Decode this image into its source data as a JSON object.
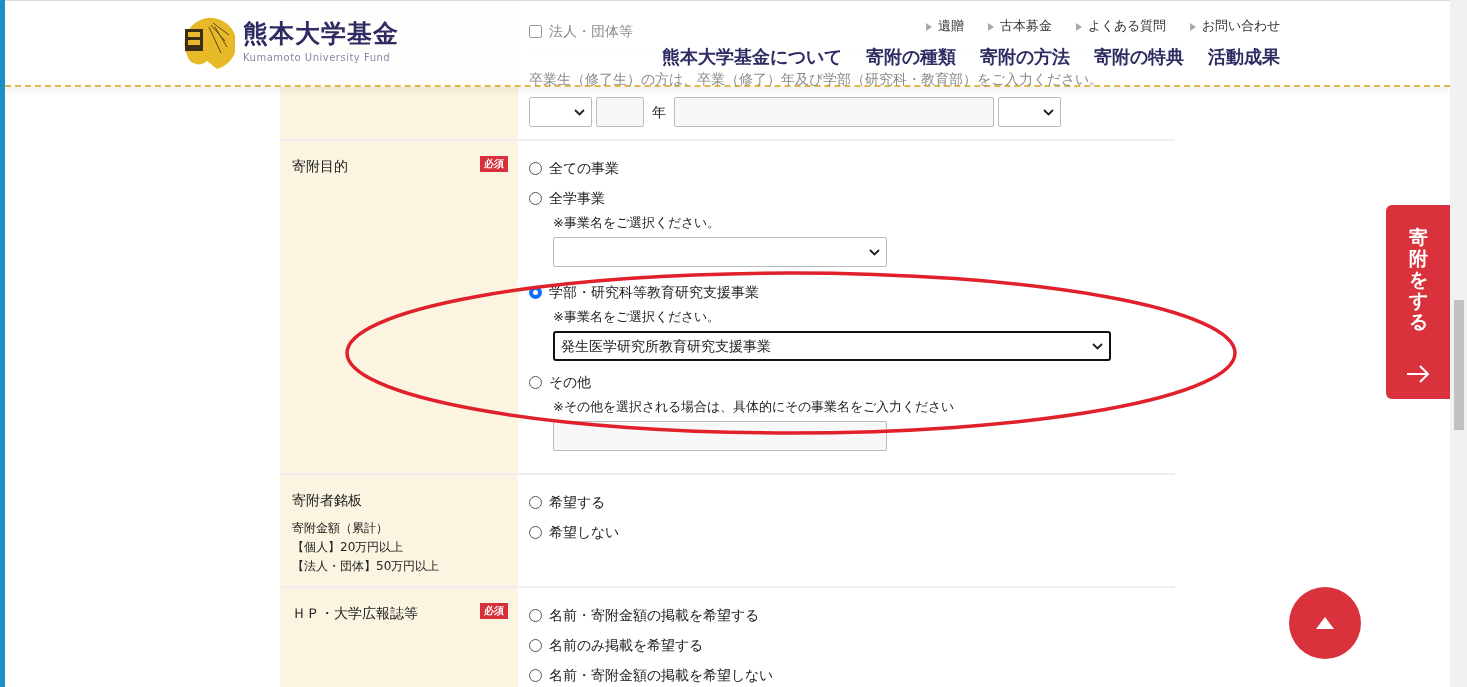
{
  "header": {
    "logo": {
      "title": "熊本大学基金",
      "subtitle": "Kumamoto University Fund"
    },
    "top_links": [
      "遺贈",
      "古本募金",
      "よくある質問",
      "お問い合わせ"
    ],
    "main_nav": [
      "熊本大学基金について",
      "寄附の種類",
      "寄附の方法",
      "寄附の特典",
      "活動成果"
    ]
  },
  "form": {
    "rows": [
      {
        "items": [
          {
            "kind": "checkbox",
            "label": "法人・団体等",
            "checked": false
          },
          {
            "kind": "rule"
          },
          {
            "kind": "note",
            "text": "卒業生（修了生）の方は、卒業（修了）年及び学部（研究科・教育部）をご入力ください。"
          },
          {
            "kind": "field_row",
            "fields": [
              {
                "kind": "select"
              },
              {
                "kind": "input"
              },
              {
                "kind": "text",
                "text": "年"
              },
              {
                "kind": "input"
              },
              {
                "kind": "select"
              }
            ]
          }
        ]
      },
      {
        "label": "寄附目的",
        "badge": "必須",
        "items": [
          {
            "kind": "radio",
            "label": "全ての事業",
            "selected": false
          },
          {
            "kind": "radio",
            "label": "全学事業",
            "selected": false
          },
          {
            "kind": "note",
            "text": "※事業名をご選択ください。"
          },
          {
            "kind": "select"
          },
          {
            "kind": "radio",
            "label": "学部・研究科等教育研究支援事業",
            "selected": true
          },
          {
            "kind": "note",
            "text": "※事業名をご選択ください。"
          },
          {
            "kind": "select",
            "value": "発生医学研究所教育研究支援事業"
          },
          {
            "kind": "radio",
            "label": "その他",
            "selected": false
          },
          {
            "kind": "note",
            "text": "※その他を選択される場合は、具体的にその事業名をご入力ください"
          },
          {
            "kind": "input"
          }
        ]
      },
      {
        "label": "寄附者銘板",
        "notes": [
          "寄附金額（累計）",
          "【個人】20万円以上",
          "【法人・団体】50万円以上"
        ],
        "items": [
          {
            "kind": "radio",
            "label": "希望する",
            "selected": false
          },
          {
            "kind": "radio",
            "label": "希望しない",
            "selected": false
          }
        ]
      },
      {
        "label": "ＨＰ・大学広報誌等",
        "badge": "必須",
        "items": [
          {
            "kind": "radio",
            "label": "名前・寄附金額の掲載を希望する",
            "selected": false
          },
          {
            "kind": "radio",
            "label": "名前のみ掲載を希望する",
            "selected": false
          },
          {
            "kind": "radio",
            "label": "名前・寄附金額の掲載を希望しない",
            "selected": false
          }
        ]
      }
    ]
  },
  "side_tab": {
    "label": "寄附をする"
  }
}
